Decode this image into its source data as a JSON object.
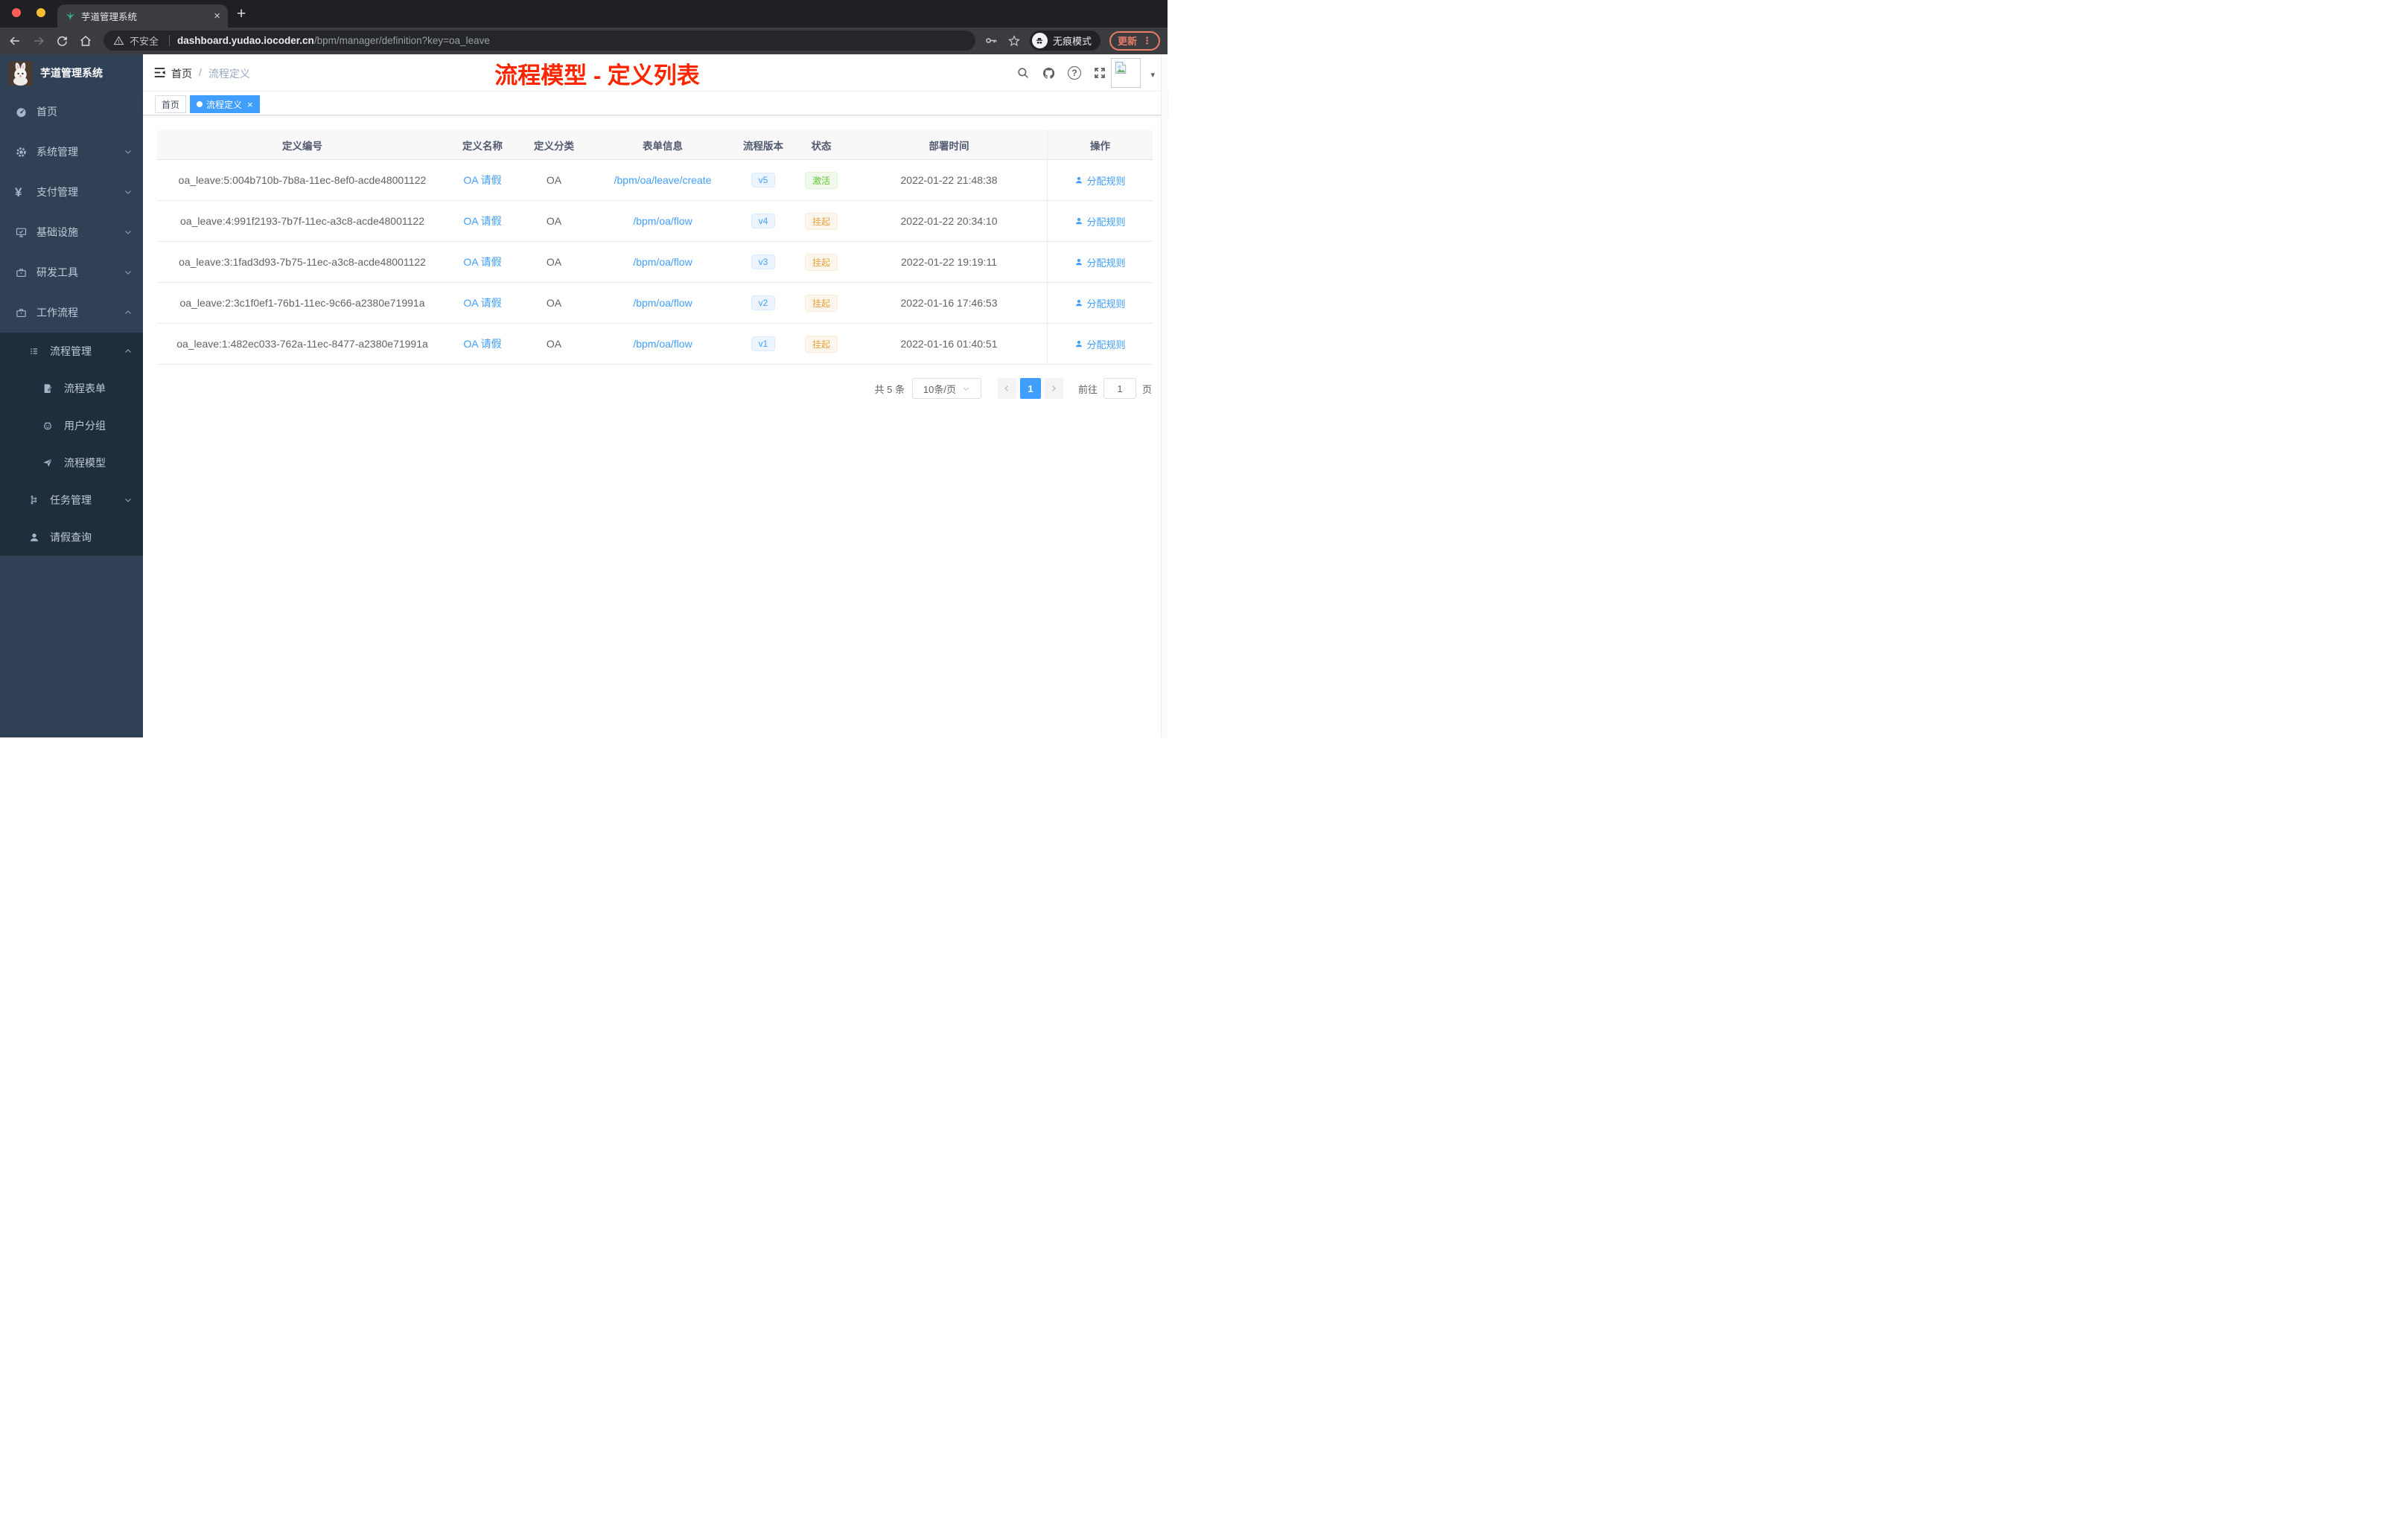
{
  "browser": {
    "tab_title": "芋道管理系统",
    "security_label": "不安全",
    "url_domain": "dashboard.yudao.iocoder.cn",
    "url_path": "/bpm/manager/definition?key=oa_leave",
    "incognito_label": "无痕模式",
    "update_label": "更新"
  },
  "icons": {
    "close": "×",
    "plus": "+",
    "menu_dots": "⋮",
    "caret_down": "▾",
    "help_glyph": "?",
    "yen": "¥"
  },
  "sidebar": {
    "app_title": "芋道管理系统",
    "items": [
      {
        "label": "首页"
      },
      {
        "label": "系统管理"
      },
      {
        "label": "支付管理"
      },
      {
        "label": "基础设施"
      },
      {
        "label": "研发工具"
      },
      {
        "label": "工作流程"
      },
      {
        "label": "流程管理"
      },
      {
        "label": "流程表单"
      },
      {
        "label": "用户分组"
      },
      {
        "label": "流程模型"
      },
      {
        "label": "任务管理"
      },
      {
        "label": "请假查询"
      }
    ]
  },
  "navbar": {
    "breadcrumb_home": "首页",
    "breadcrumb_sep": "/",
    "breadcrumb_current": "流程定义",
    "annotation": "流程模型 - 定义列表"
  },
  "tags": {
    "home": "首页",
    "active": "流程定义"
  },
  "table": {
    "headers": [
      "定义编号",
      "定义名称",
      "定义分类",
      "表单信息",
      "流程版本",
      "状态",
      "部署时间",
      "操作"
    ],
    "rows": [
      {
        "id": "oa_leave:5:004b710b-7b8a-11ec-8ef0-acde48001122",
        "name": "OA 请假",
        "category": "OA",
        "form": "/bpm/oa/leave/create",
        "version": "v5",
        "status": "激活",
        "time": "2022-01-22 21:48:38",
        "action": "分配规则"
      },
      {
        "id": "oa_leave:4:991f2193-7b7f-11ec-a3c8-acde48001122",
        "name": "OA 请假",
        "category": "OA",
        "form": "/bpm/oa/flow",
        "version": "v4",
        "status": "挂起",
        "time": "2022-01-22 20:34:10",
        "action": "分配规则"
      },
      {
        "id": "oa_leave:3:1fad3d93-7b75-11ec-a3c8-acde48001122",
        "name": "OA 请假",
        "category": "OA",
        "form": "/bpm/oa/flow",
        "version": "v3",
        "status": "挂起",
        "time": "2022-01-22 19:19:11",
        "action": "分配规则"
      },
      {
        "id": "oa_leave:2:3c1f0ef1-76b1-11ec-9c66-a2380e71991a",
        "name": "OA 请假",
        "category": "OA",
        "form": "/bpm/oa/flow",
        "version": "v2",
        "status": "挂起",
        "time": "2022-01-16 17:46:53",
        "action": "分配规则"
      },
      {
        "id": "oa_leave:1:482ec033-762a-11ec-8477-a2380e71991a",
        "name": "OA 请假",
        "category": "OA",
        "form": "/bpm/oa/flow",
        "version": "v1",
        "status": "挂起",
        "time": "2022-01-16 01:40:51",
        "action": "分配规则"
      }
    ]
  },
  "pagination": {
    "total": "共 5 条",
    "page_size": "10条/页",
    "current": "1",
    "goto": "前往",
    "goto_value": "1",
    "unit": "页"
  },
  "colors": {
    "accent": "#409eff",
    "annotation_red": "#fb2600",
    "status_active": "#67c23a",
    "status_suspended": "#e6a23c",
    "sidebar_bg": "#304156",
    "submenu_bg": "#1f2d3d"
  }
}
